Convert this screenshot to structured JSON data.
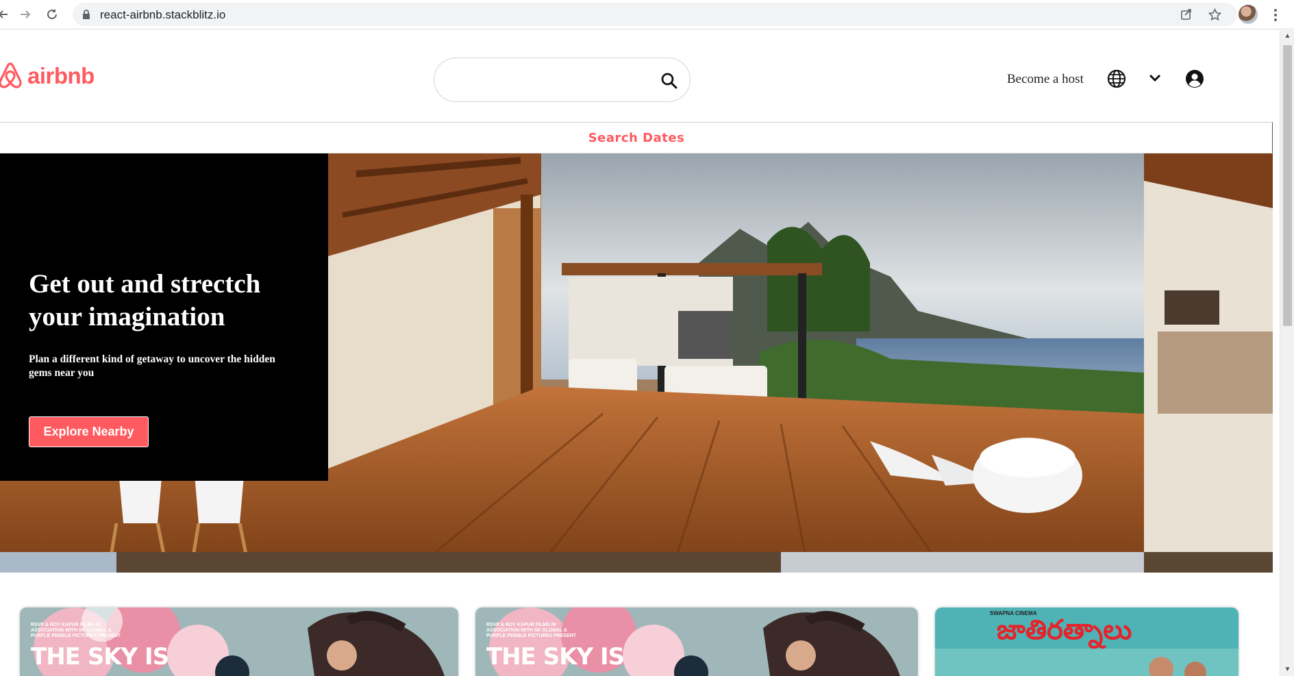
{
  "browser": {
    "url": "react-airbnb.stackblitz.io",
    "icons": [
      "back-arrow-icon",
      "forward-arrow-icon",
      "reload-icon",
      "lock-icon",
      "share-icon",
      "star-icon",
      "profile-avatar",
      "kebab-menu-icon"
    ]
  },
  "header": {
    "logo_text": "airbnb",
    "search_placeholder": "",
    "become_host": "Become a host",
    "icons": [
      "search-icon",
      "globe-icon",
      "chevron-down-icon",
      "account-circle-icon"
    ]
  },
  "dates_bar": {
    "label": "Search Dates"
  },
  "hero": {
    "title": "Get out and strectch your imagination",
    "subtitle": "Plan a different kind of getaway to uncover the hidden gems near you",
    "button_label": "Explore Nearby"
  },
  "cards": [
    {
      "poster_title": "THE SKY IS",
      "poster_credits": "RSVP & ROY KAPUR FILMS IN ASSOCIATION WITH SK GLOBAL & PURPLE PEBBLE PICTURES PRESENT"
    },
    {
      "poster_title": "THE SKY IS",
      "poster_credits": "RSVP & ROY KAPUR FILMS IN ASSOCIATION WITH SK GLOBAL & PURPLE PEBBLE PICTURES PRESENT"
    },
    {
      "poster_title": "జాతిరత్నాలు",
      "poster_credits": "SWAPNA CINEMA"
    }
  ],
  "colors": {
    "brand": "#ff5a5f",
    "hero_card_bg": "#000000"
  }
}
